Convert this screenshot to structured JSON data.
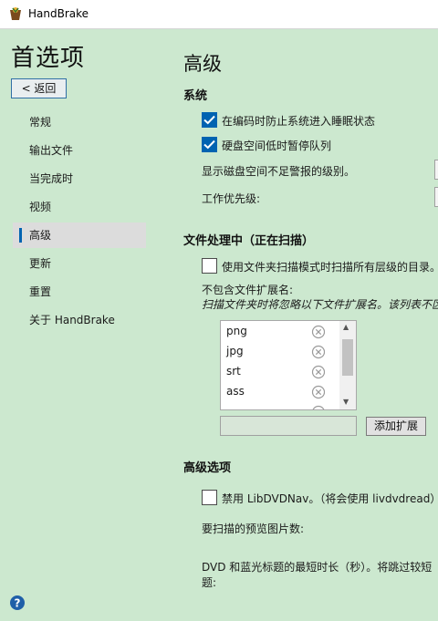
{
  "window": {
    "title": "HandBrake"
  },
  "sidebar": {
    "heading": "首选项",
    "back_label": "< 返回",
    "items": [
      {
        "label": "常规"
      },
      {
        "label": "输出文件"
      },
      {
        "label": "当完成时"
      },
      {
        "label": "视频"
      },
      {
        "label": "高级",
        "active": true
      },
      {
        "label": "更新"
      },
      {
        "label": "重置"
      },
      {
        "label": "关于 HandBrake"
      }
    ]
  },
  "main": {
    "title": "高级",
    "system": {
      "heading": "系统",
      "prevent_sleep": {
        "label": "在编码时防止系统进入睡眠状态",
        "checked": true
      },
      "pause_low_disk": {
        "label": "硬盘空间低时暂停队列",
        "checked": true
      },
      "low_disk_warning_label": "显示磁盘空间不足警报的级别。",
      "priority_label": "工作优先级:"
    },
    "file_handling": {
      "heading": "文件处理中（正在扫描）",
      "recursive_scan": {
        "label": "使用文件夹扫描模式时扫描所有层级的目录。",
        "checked": false
      },
      "exclude_label": "不包含文件扩展名:",
      "exclude_hint": "扫描文件夹时将忽略以下文件扩展名。该列表不区",
      "extensions": [
        "png",
        "jpg",
        "srt",
        "ass"
      ],
      "add_extension_label": "添加扩展",
      "new_extension_value": ""
    },
    "advanced": {
      "heading": "高级选项",
      "disable_libdvdnav": {
        "label": "禁用 LibDVDNav。（将会使用 livdvdread）",
        "checked": false
      },
      "preview_count_label": "要扫描的预览图片数:",
      "min_title_duration_label_line1": "DVD 和蓝光标题的最短时长（秒）。将跳过较短",
      "min_title_duration_label_line2": "题:"
    }
  },
  "colors": {
    "background": "#cce8cf",
    "accent": "#0063b1",
    "titlebar": "#ffffff"
  }
}
